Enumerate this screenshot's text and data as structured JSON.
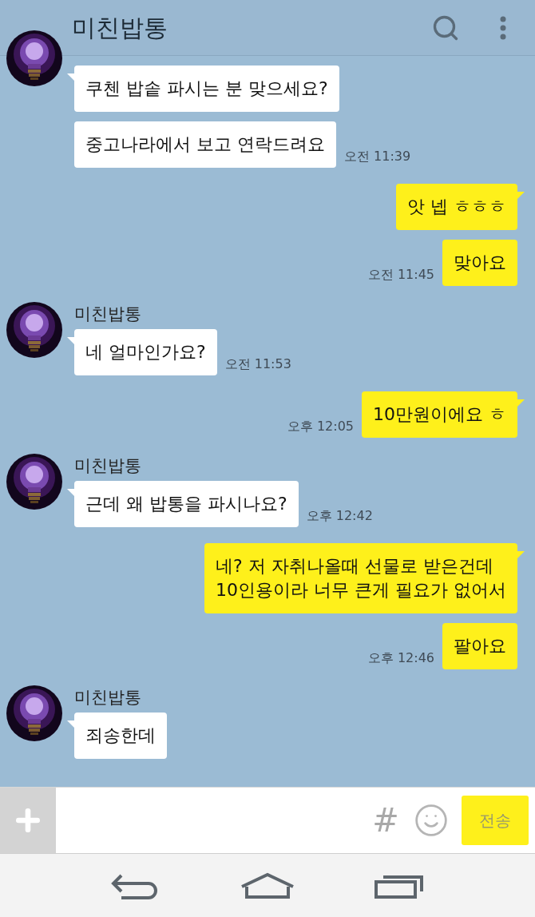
{
  "header": {
    "title": "미친밥통"
  },
  "groups": [
    {
      "kind": "received",
      "messages": [
        {
          "text": "쿠첸 밥솥 파시는 분 맞으세요?"
        },
        {
          "text": "중고나라에서 보고 연락드려요",
          "time": "오전 11:39"
        }
      ]
    },
    {
      "kind": "sent",
      "messages": [
        {
          "text": "앗 넵 ㅎㅎㅎ"
        },
        {
          "text": "맞아요",
          "time": "오전 11:45"
        }
      ]
    },
    {
      "kind": "received",
      "sender": "미친밥통",
      "messages": [
        {
          "text": "네 얼마인가요?",
          "time": "오전 11:53"
        }
      ]
    },
    {
      "kind": "sent",
      "messages": [
        {
          "text": "10만원이에요 ㅎ",
          "time": "오후 12:05"
        }
      ]
    },
    {
      "kind": "received",
      "sender": "미친밥통",
      "messages": [
        {
          "text": "근데 왜 밥통을 파시나요?",
          "time": "오후 12:42"
        }
      ]
    },
    {
      "kind": "sent",
      "messages": [
        {
          "text": "네? 저 자취나올때 선물로 받은건데\n10인용이라 너무 큰게 필요가 없어서"
        },
        {
          "text": "팔아요",
          "time": "오후 12:46"
        }
      ]
    },
    {
      "kind": "received",
      "sender": "미친밥통",
      "messages": [
        {
          "text": "죄송한데"
        }
      ]
    }
  ],
  "input": {
    "hash": "#",
    "send": "전송"
  }
}
